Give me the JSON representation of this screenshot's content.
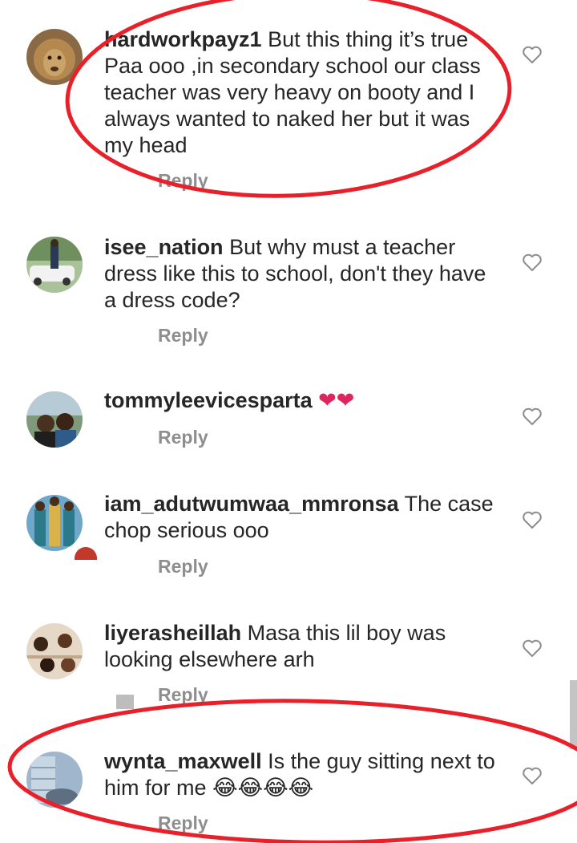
{
  "comments": [
    {
      "username": "hardworkpayz1",
      "text": " But this thing it’s true Paa ooo ,in secondary school our class teacher was very heavy on booty and I always wanted to naked her but it was my head",
      "reply_label": "Reply",
      "avatar": "lion-avatar"
    },
    {
      "username": "isee_nation",
      "text": " But why must a teacher dress like this to school, don't they have a dress code?",
      "reply_label": "Reply",
      "avatar": "man-with-car-avatar"
    },
    {
      "username": "tommyleevicesparta",
      "text": " ❤❤",
      "reply_label": "Reply",
      "avatar": "two-people-avatar"
    },
    {
      "username": "iam_adutwumwaa_mmronsa",
      "text": " The case chop serious ooo",
      "reply_label": "Reply",
      "avatar": "women-collage-avatar"
    },
    {
      "username": "liyerasheillah",
      "text": " Masa this lil boy was looking elsewhere arh",
      "reply_label": "Reply",
      "avatar": "group-photo-avatar"
    },
    {
      "username": "wynta_maxwell",
      "text": " Is the guy sitting next to him for me 😂😂😂😂",
      "reply_label": "Reply",
      "avatar": "building-avatar"
    }
  ],
  "colors": {
    "username": "#262626",
    "reply": "#8e8e8e",
    "annotation_ellipse": "#e8202a",
    "heart_outline": "#8e8e8e"
  }
}
